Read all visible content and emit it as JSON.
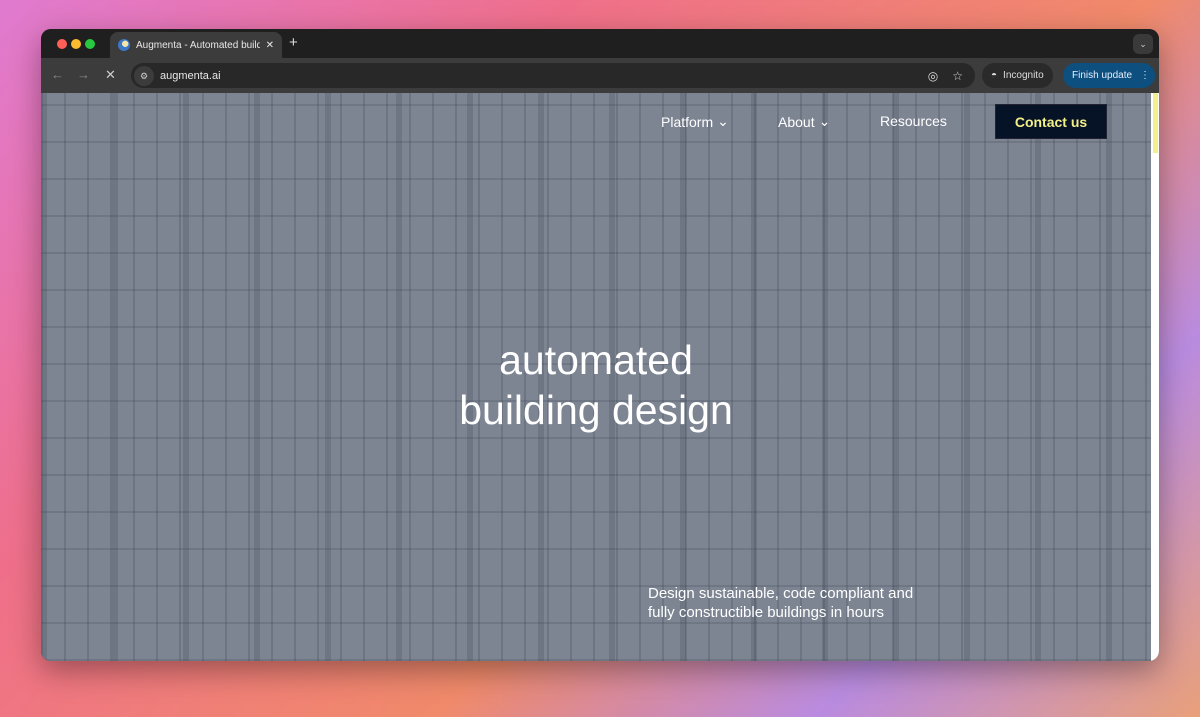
{
  "browser": {
    "tab_title": "Augmenta - Automated buildi",
    "url": "augmenta.ai",
    "incognito_label": "Incognito",
    "update_label": "Finish update"
  },
  "site": {
    "nav": [
      {
        "label": "Platform",
        "has_dropdown": true
      },
      {
        "label": "About",
        "has_dropdown": true
      },
      {
        "label": "Resources",
        "has_dropdown": false
      }
    ],
    "contact_label": "Contact us",
    "hero_line1": "automated",
    "hero_line2": "building design",
    "subtitle_line1": "Design sustainable, code compliant and",
    "subtitle_line2": "fully constructible buildings in hours",
    "accent_color": "#f3f08a",
    "contact_bg": "#061226"
  }
}
